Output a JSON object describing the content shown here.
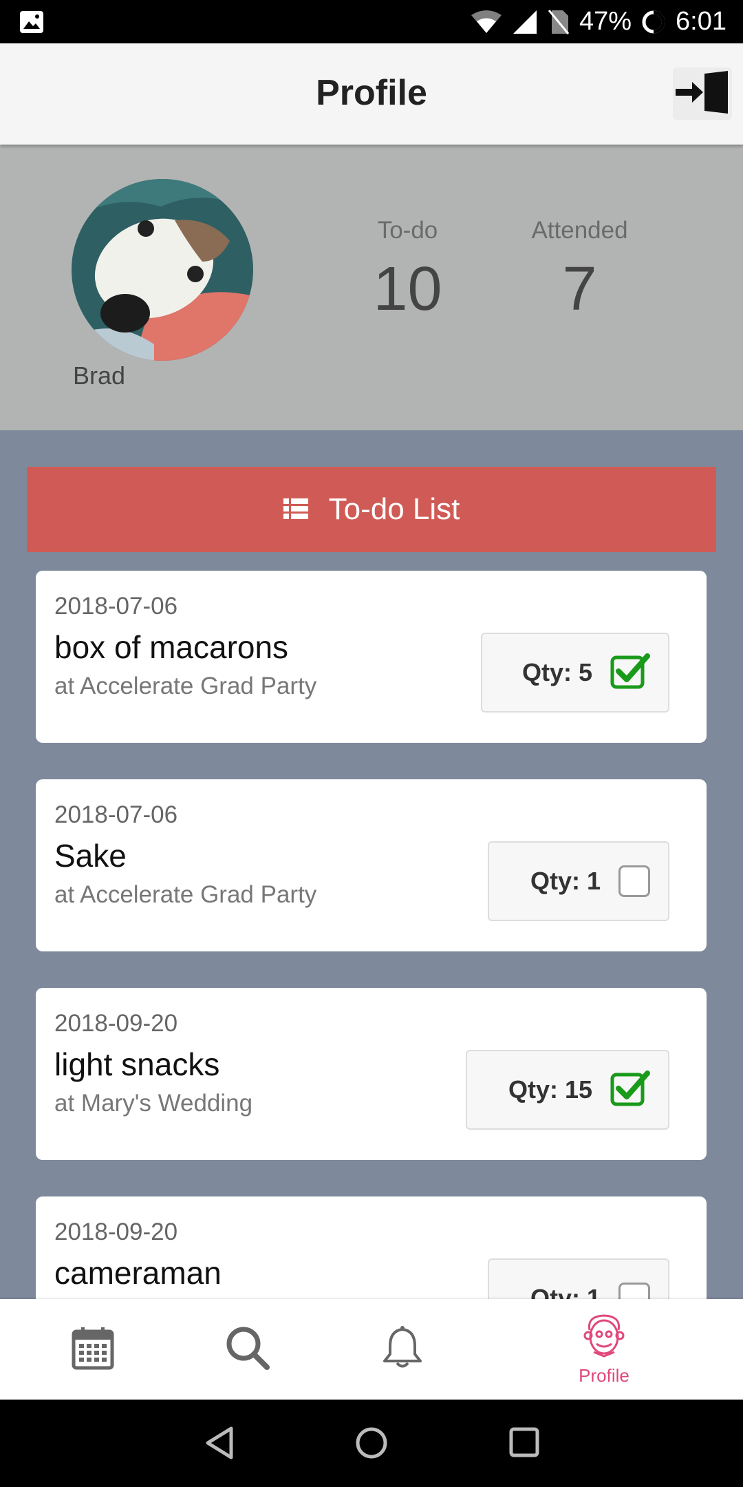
{
  "status_bar": {
    "battery": "47%",
    "time": "6:01"
  },
  "header": {
    "title": "Profile"
  },
  "profile": {
    "name": "Brad",
    "stats": [
      {
        "label": "To-do",
        "value": "10"
      },
      {
        "label": "Attended",
        "value": "7"
      }
    ]
  },
  "todo_banner": {
    "label": "To-do List"
  },
  "todos": [
    {
      "date": "2018-07-06",
      "item": "box of macarons",
      "place": "at Accelerate Grad Party",
      "qty": "Qty: 5",
      "checked": true
    },
    {
      "date": "2018-07-06",
      "item": "Sake",
      "place": "at Accelerate Grad Party",
      "qty": "Qty: 1",
      "checked": false
    },
    {
      "date": "2018-09-20",
      "item": "light snacks",
      "place": "at Mary's Wedding",
      "qty": "Qty: 15",
      "checked": true
    },
    {
      "date": "2018-09-20",
      "item": "cameraman",
      "place": "",
      "qty": "Qty: 1",
      "checked": false
    }
  ],
  "bottom_nav": {
    "items": [
      {
        "icon": "calendar-icon",
        "label": ""
      },
      {
        "icon": "search-icon",
        "label": ""
      },
      {
        "icon": "bell-icon",
        "label": ""
      },
      {
        "icon": "profile-icon",
        "label": "Profile"
      }
    ],
    "active_color": "#e0487a"
  },
  "colors": {
    "banner": "#d05b56",
    "list_bg": "#7e8a9c",
    "profile_bg": "#b2b4b3",
    "check": "#1a9a1a"
  }
}
